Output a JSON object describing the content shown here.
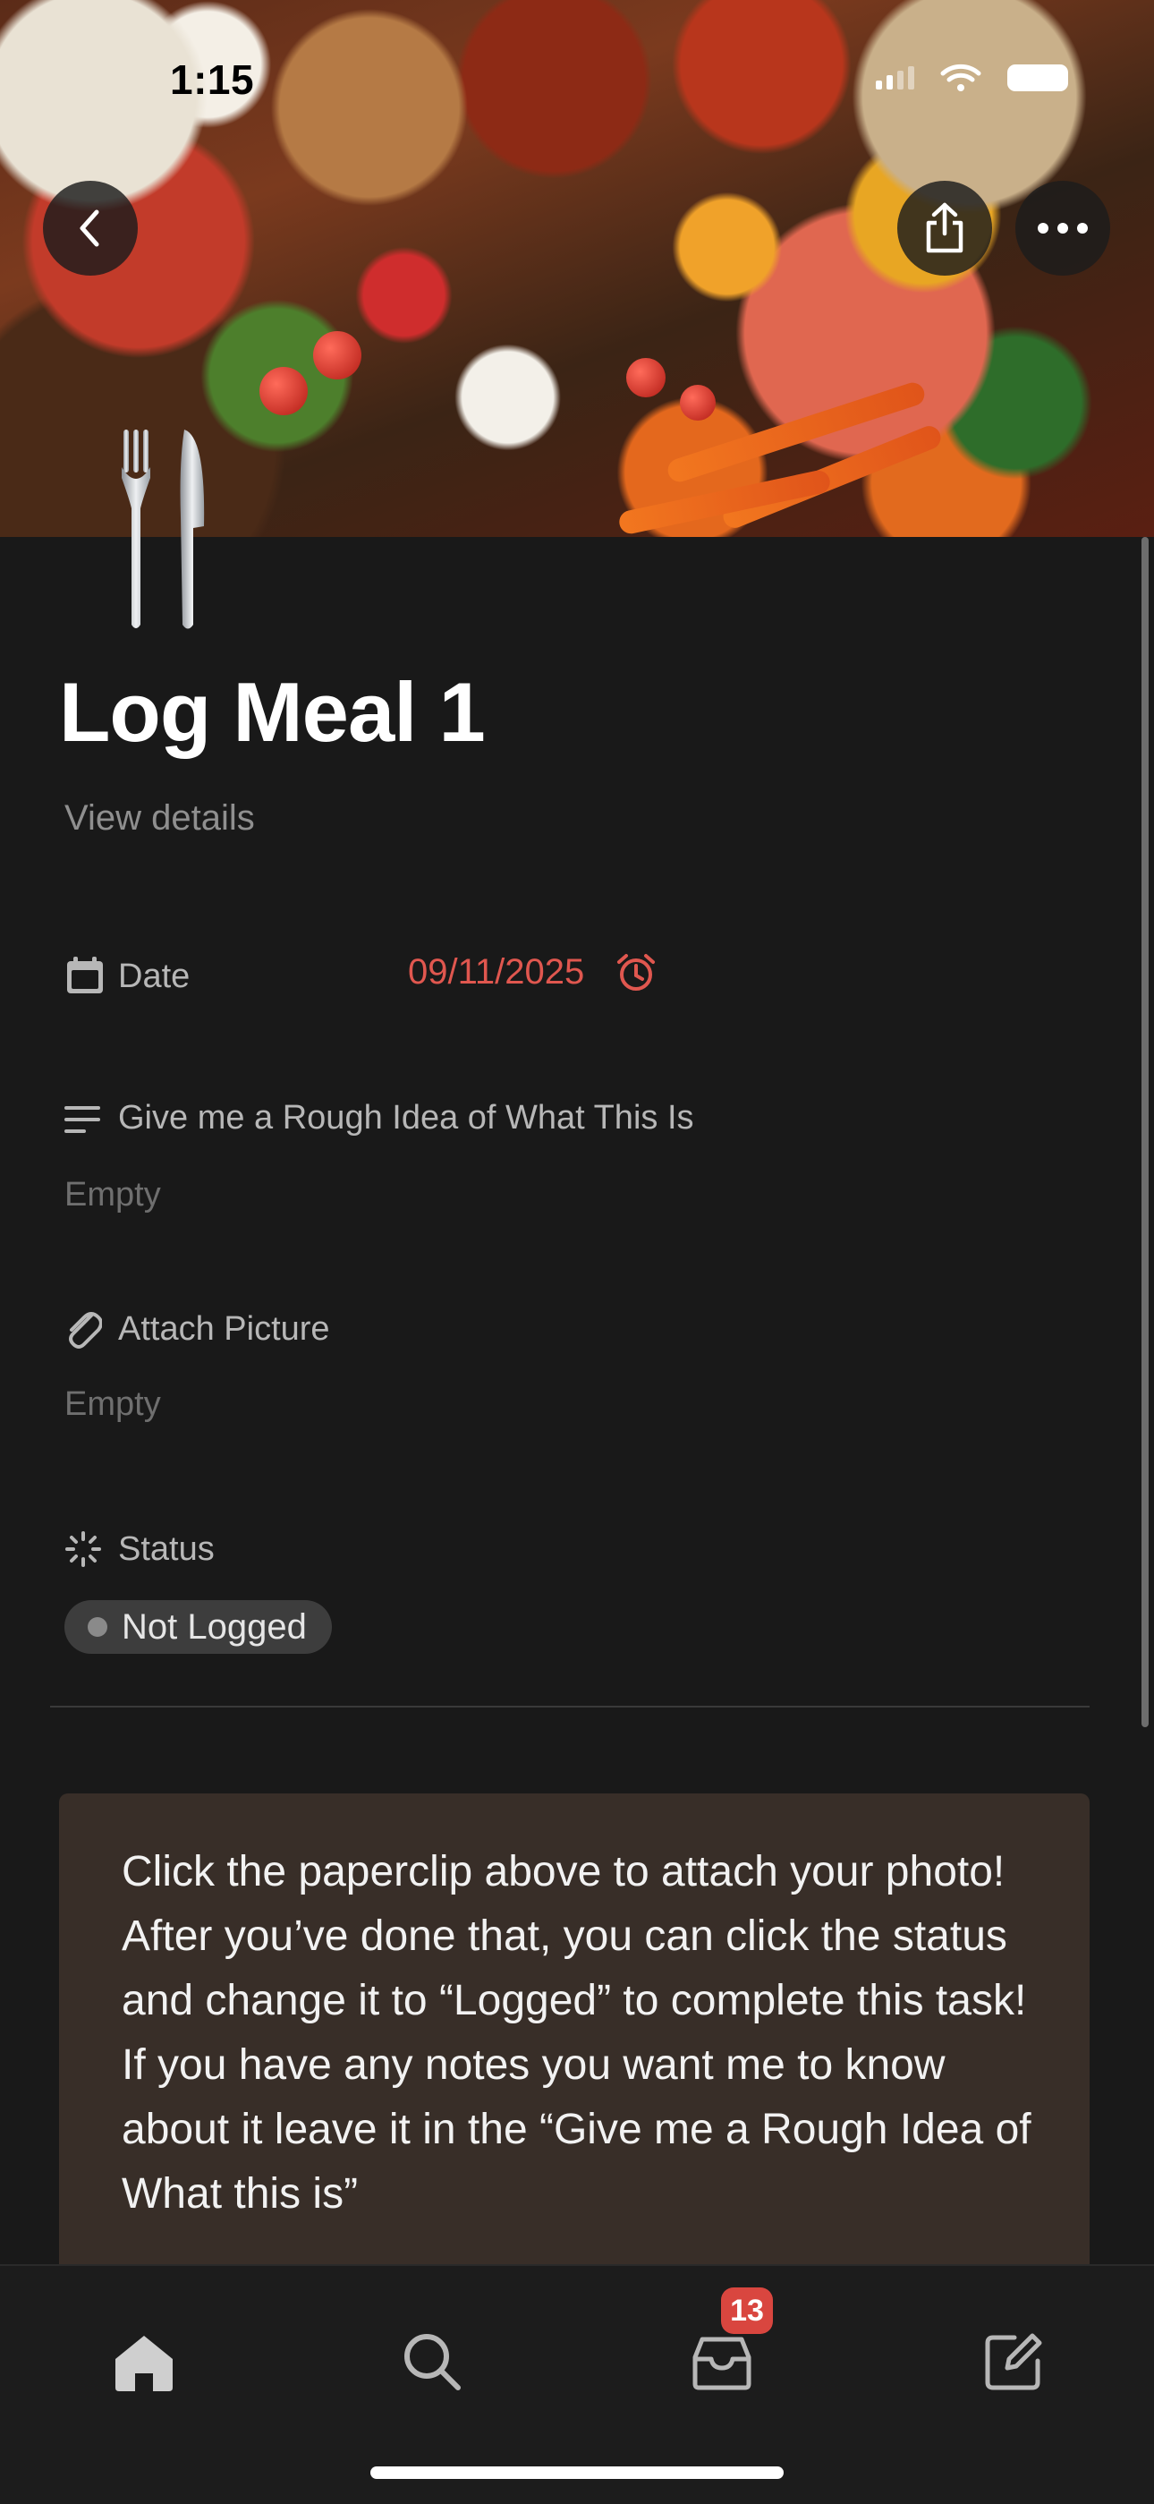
{
  "status_bar": {
    "time": "1:15"
  },
  "header": {
    "back_icon": "chevron-left-icon",
    "share_icon": "share-icon",
    "more_icon": "ellipsis-icon"
  },
  "page": {
    "icon": "fork-and-knife-icon",
    "title": "Log Meal 1",
    "view_details": "View details"
  },
  "properties": {
    "date": {
      "label": "Date",
      "value": "09/11/2025",
      "icon": "calendar-icon",
      "reminder_icon": "alarm-clock-icon",
      "value_color": "#e0574f"
    },
    "rough_idea": {
      "label": "Give me a Rough Idea of What This Is",
      "value": "Empty",
      "icon": "text-lines-icon"
    },
    "attach_picture": {
      "label": "Attach Picture",
      "value": "Empty",
      "icon": "paperclip-icon"
    },
    "status": {
      "label": "Status",
      "value": "Not Logged",
      "icon": "status-spinner-icon"
    }
  },
  "callout": {
    "text": "Click the paperclip above to attach your photo! After you’ve done that, you can click the status and change it to “Logged” to complete this task! If you have any notes you want me to know about it leave it in the “Give me a Rough Idea of What this is”",
    "background": "#382e28"
  },
  "tab_bar": {
    "items": [
      "home-icon",
      "search-icon",
      "inbox-icon",
      "compose-icon"
    ],
    "inbox_badge": "13",
    "badge_color": "#d9463f"
  }
}
